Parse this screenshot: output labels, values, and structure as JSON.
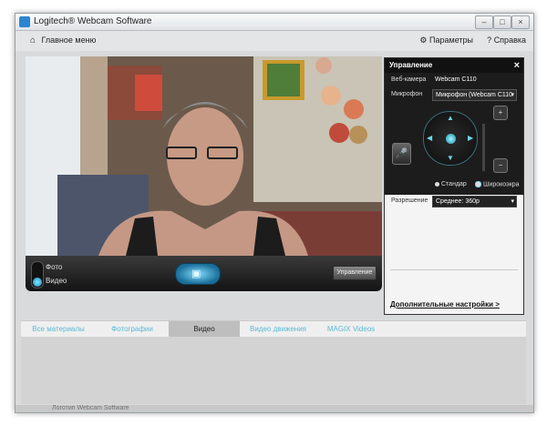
{
  "window": {
    "title": "Logitech® Webcam Software"
  },
  "toolbar": {
    "home_label": "Главное меню",
    "settings_label": "Параметры",
    "help_label": "Справка"
  },
  "capture": {
    "mode_photo": "Фото",
    "mode_video": "Видео",
    "selected_mode": "Видео",
    "manage_label": "Управление"
  },
  "panel": {
    "title": "Управление",
    "webcam_label": "Веб-камера",
    "webcam_value": "Webcam C110",
    "mic_label": "Микрофон",
    "mic_value": "Микрофон (Webcam C110",
    "aspect_standard": "Стандар",
    "aspect_wide": "Широкоэкра",
    "aspect_selected": "Широкоэкра",
    "resolution_label": "Разрешение",
    "resolution_value": "Среднее: 360p",
    "advanced_link": "Дополнительные настройки >"
  },
  "tabs": [
    {
      "label": "Все материалы"
    },
    {
      "label": "Фотографии"
    },
    {
      "label": "Видео"
    },
    {
      "label": "Видео движения"
    },
    {
      "label": "MAGIX Videos"
    }
  ],
  "active_tab": "Видео",
  "statusbar": {
    "text": "Логотип Webcam Software"
  },
  "colors": {
    "accent": "#5bb9d6",
    "panel_dark": "#1c1c1c",
    "window_bg": "#d9dadb"
  },
  "icons": [
    "app-icon",
    "home-icon",
    "gear-icon",
    "help-icon",
    "close-icon",
    "camera-icon",
    "microphone-icon",
    "zoom-in-icon",
    "zoom-out-icon",
    "arrow-up-icon",
    "arrow-down-icon",
    "arrow-left-icon",
    "arrow-right-icon"
  ]
}
